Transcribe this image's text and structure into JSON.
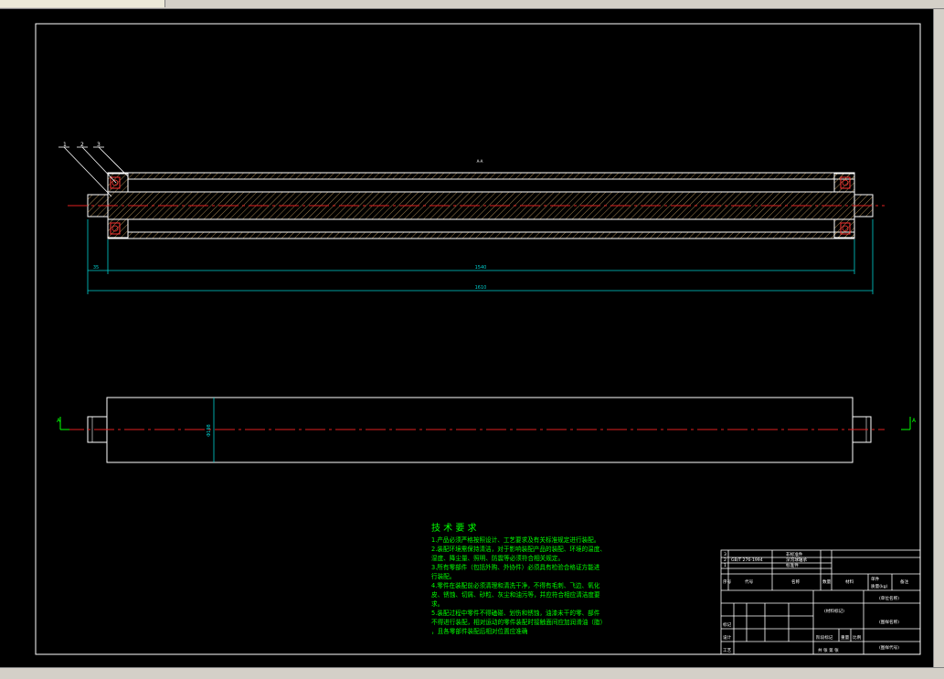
{
  "drawing": {
    "top_label": "A-A",
    "part_labels": [
      "1",
      "2",
      "3"
    ],
    "dimensions": {
      "left_offset": "35",
      "inner_length": "1540",
      "overall_length": "1610",
      "diameter": "Φ198"
    },
    "section_marks": [
      "A",
      "A"
    ]
  },
  "tech_requirements": {
    "title": "技 术 要 求",
    "lines": [
      "1.产品必须严格按照设计、工艺要求及有关标准规定进行装配。",
      "2.装配环境需保持清洁，对于影响装配产品的装配、环境的温度、",
      "湿度、降尘量、照明、防震等必须符合相关规定。",
      "3.所有零部件（包括外购、外协件）必须具有检验合格证方能进",
      "行装配。",
      "4.零件在装配前必须清理和清洗干净，不得有毛刺、飞边、氧化",
      "皮、锈蚀、切屑、砂粒、灰尘和油污等，并应符合相应清洁度要",
      "求。",
      "5.装配过程中零件不得磕碰、划伤和锈蚀，油漆未干的零、部件",
      "不得进行装配，相对运动的零件装配时接触面间应加润滑油（脂）",
      "，且各零部件装配后相对位置应准确"
    ]
  },
  "title_block": {
    "rows": [
      {
        "no": "3",
        "code": "",
        "name": "非标准件"
      },
      {
        "no": "2",
        "code": "GB/T 276-1994",
        "name": "深沟球轴承"
      },
      {
        "no": "1",
        "code": "",
        "name": "标准件"
      }
    ],
    "header": [
      "序号",
      "代号",
      "名称",
      "数量",
      "材料",
      "单件",
      "总计",
      "备注"
    ],
    "weight_label": "质量(kg)",
    "material_cell": "(材料标记)",
    "unit_cell": "(单位名称)",
    "drawing_name": "(图样名称)",
    "drawing_code": "(图样代号)",
    "labels": [
      "标记",
      "处数",
      "分区",
      "更改文件号",
      "签名",
      "年月日",
      "设计",
      "标准化",
      "审核",
      "工艺",
      "批准",
      "阶段标记",
      "重量",
      "比例",
      "共 张 第 张"
    ]
  }
}
